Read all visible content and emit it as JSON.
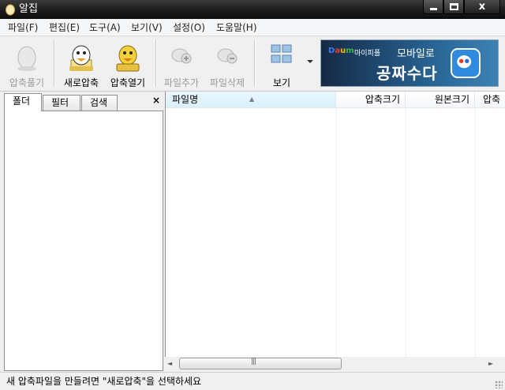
{
  "window": {
    "title": "알집"
  },
  "menu": [
    "파일(F)",
    "편집(E)",
    "도구(A)",
    "보기(V)",
    "설정(O)",
    "도움말(H)"
  ],
  "toolbar": {
    "extract": "압축풀기",
    "new_archive": "새로압축",
    "open_archive": "압축열기",
    "add_file": "파일추가",
    "delete_file": "파일삭제",
    "view": "보기"
  },
  "ad": {
    "brand": "Daum",
    "brand_sub": "마이피플",
    "line1": "모바일로",
    "line2": "공짜수다"
  },
  "left_panel": {
    "tabs": [
      "폴더",
      "필터",
      "검색"
    ],
    "close": "×"
  },
  "list": {
    "columns": [
      "파일명",
      "압축크기",
      "원본크기",
      "압축"
    ]
  },
  "scrollbar": {
    "left": "◄",
    "right": "►",
    "grip": "|||"
  },
  "status": {
    "text": "새 압축파일을 만들려면 \"새로압축\"을 선택하세요"
  }
}
